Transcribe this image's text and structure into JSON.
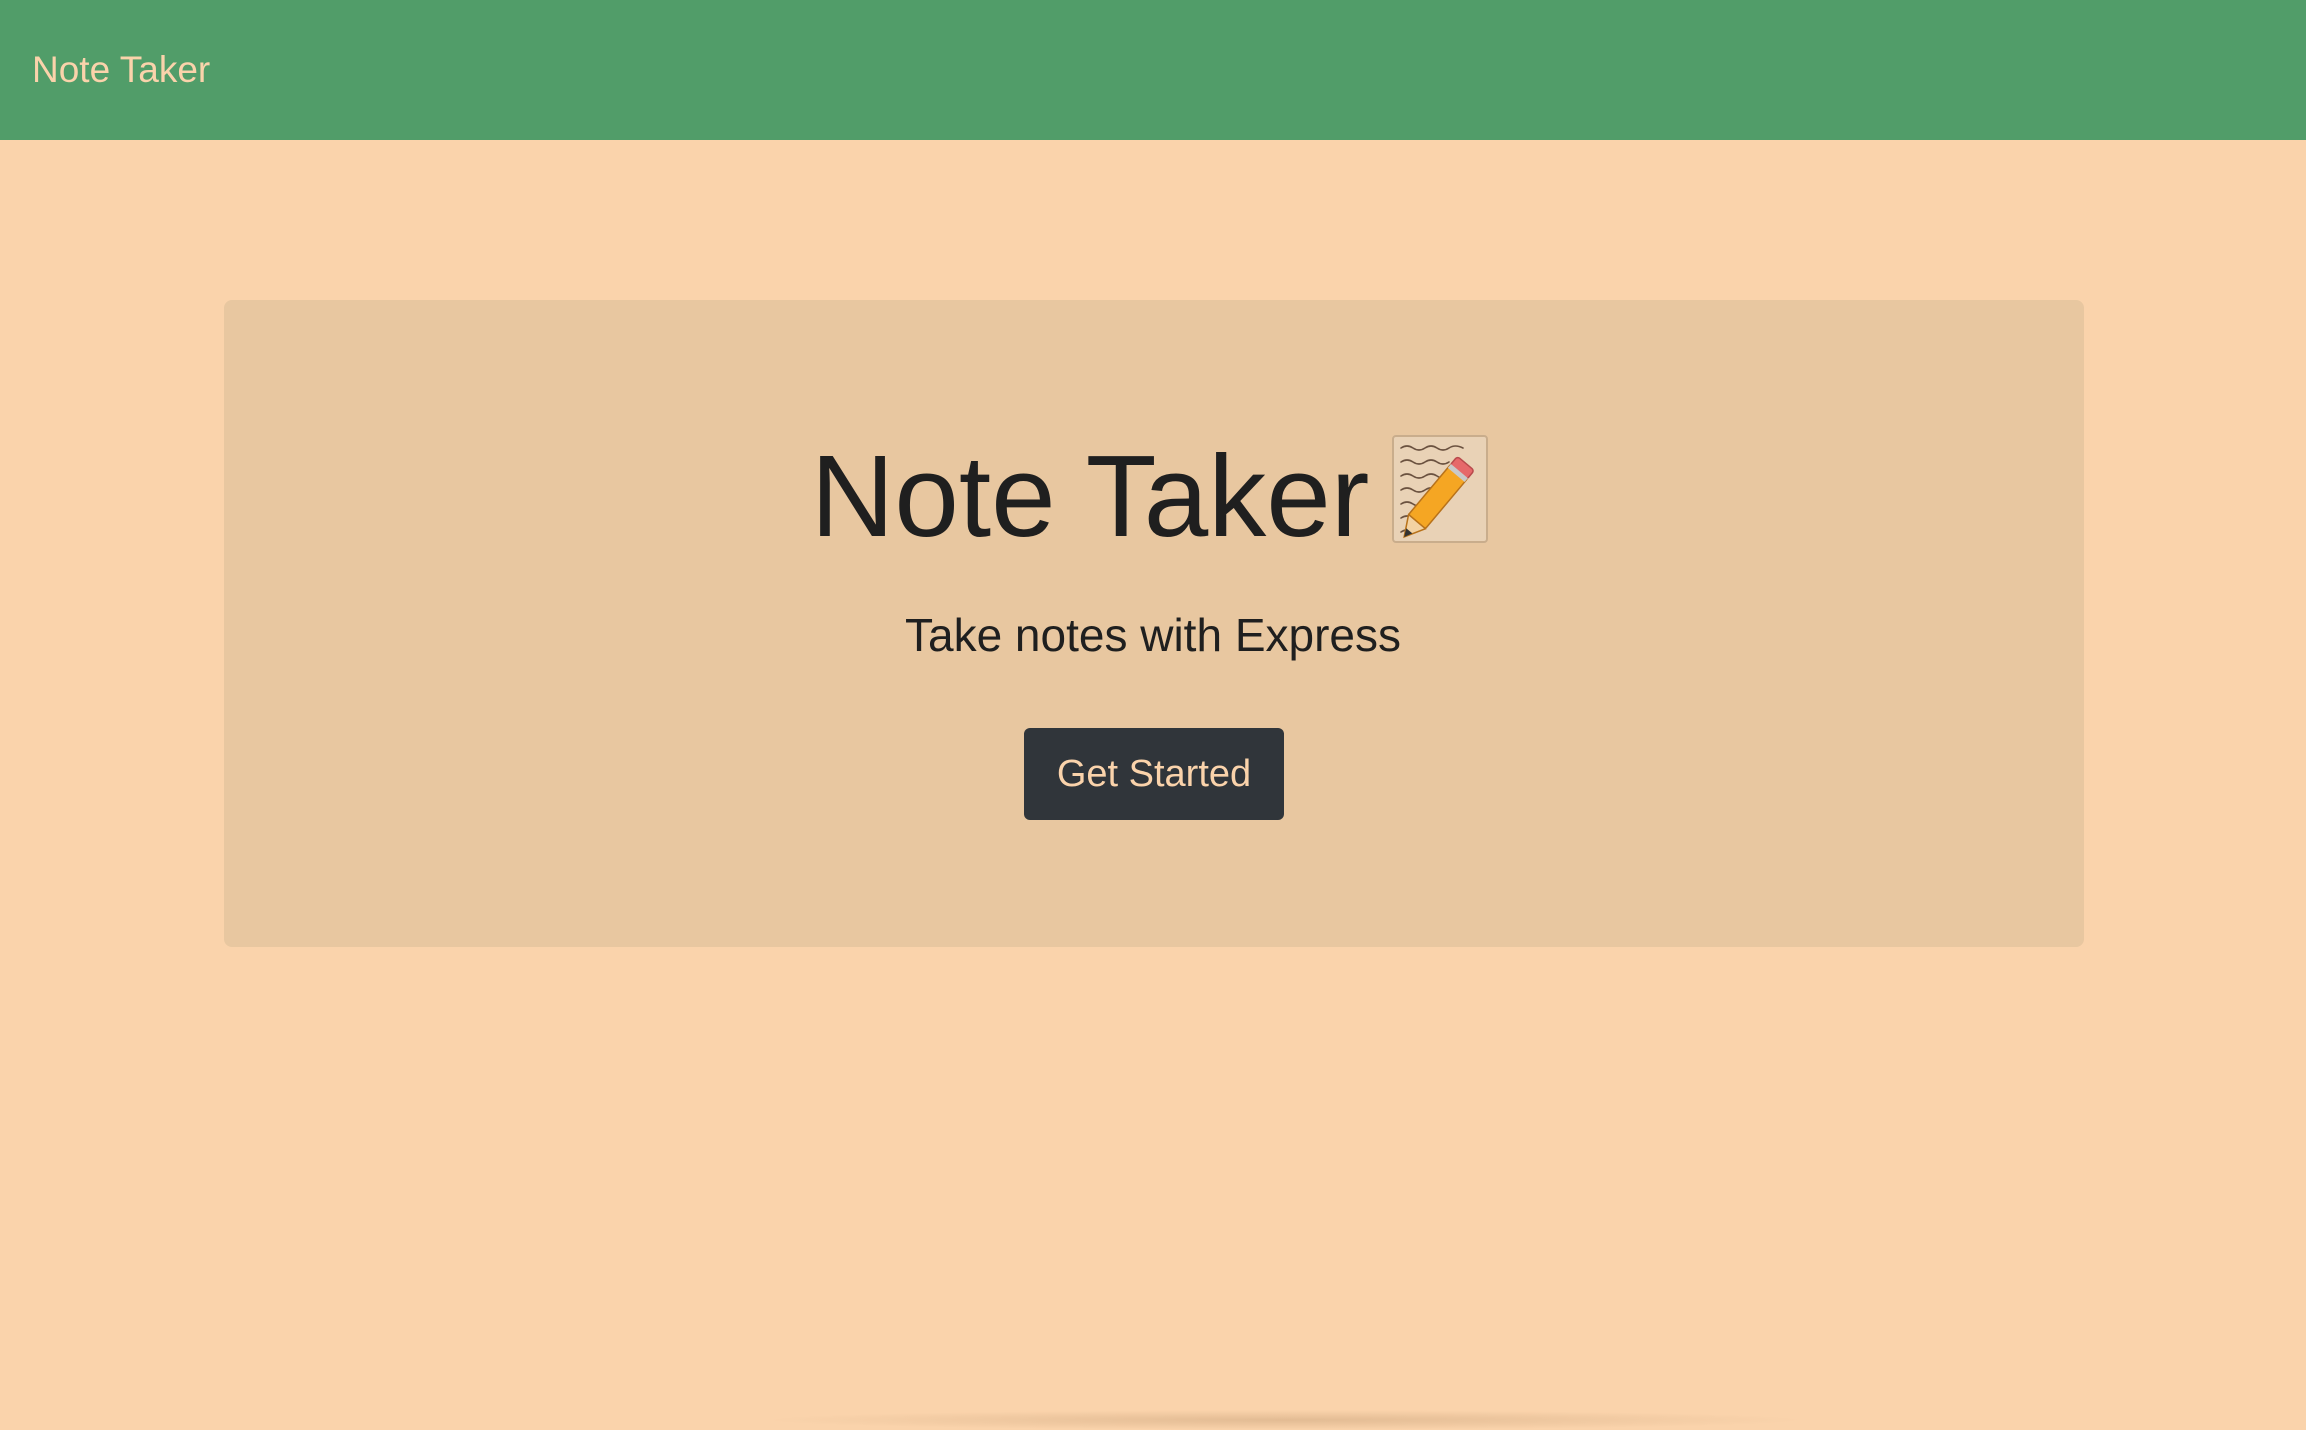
{
  "navbar": {
    "brand": "Note Taker",
    "background_color": "#519d69",
    "text_color": "#fad3ab"
  },
  "page": {
    "background_color": "#fad3ab"
  },
  "hero": {
    "title": "Note Taker",
    "title_icon": "memo-icon",
    "subtitle": "Take notes with Express",
    "cta_label": "Get Started",
    "card_color": "#e8c7a0",
    "cta_color": "#30353a"
  }
}
